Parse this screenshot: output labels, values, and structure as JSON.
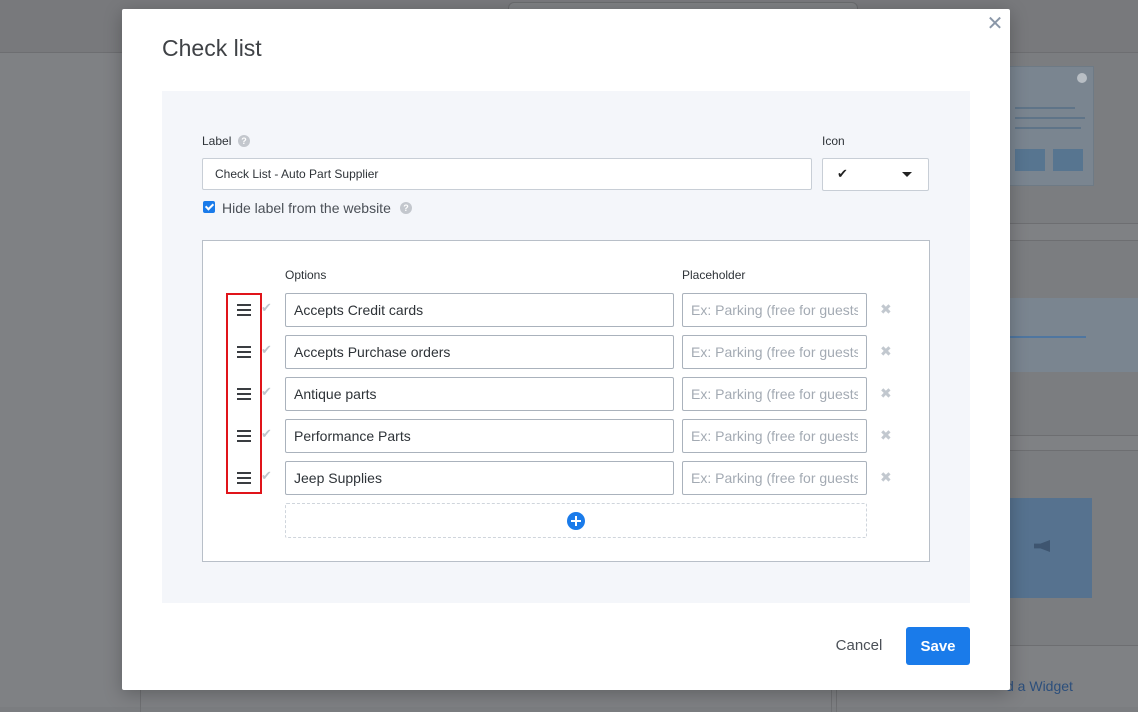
{
  "background": {
    "link_text": "d a Widget"
  },
  "modal": {
    "title": "Check list",
    "close_icon": "close-icon",
    "label_field": {
      "label": "Label",
      "value": "Check List - Auto Part Supplier"
    },
    "icon_field": {
      "label": "Icon",
      "selected_icon": "checkmark-icon",
      "selected_glyph": "✔"
    },
    "hide_label": {
      "checked": true,
      "text": "Hide label from the website"
    },
    "options_table": {
      "options_header": "Options",
      "placeholder_header": "Placeholder",
      "rows": [
        {
          "option": "Accepts Credit cards",
          "placeholder": "Ex: Parking (free for guests)"
        },
        {
          "option": "Accepts Purchase orders",
          "placeholder": "Ex: Parking (free for guests)"
        },
        {
          "option": "Antique parts",
          "placeholder": "Ex: Parking (free for guests)"
        },
        {
          "option": "Performance Parts",
          "placeholder": "Ex: Parking (free for guests)"
        },
        {
          "option": "Jeep Supplies",
          "placeholder": "Ex: Parking (free for guests)"
        }
      ]
    },
    "footer": {
      "cancel_label": "Cancel",
      "save_label": "Save"
    }
  },
  "colors": {
    "accent": "#1a7bea",
    "highlight": "#e0141a"
  }
}
